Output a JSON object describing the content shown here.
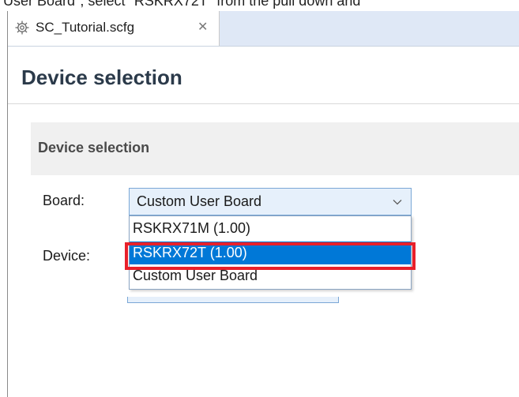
{
  "caption": "User Board\", select \"RSKRX72T\" from the pull down and",
  "tab": {
    "title": "SC_Tutorial.scfg",
    "icon": "gear-icon",
    "close_icon": "close-icon"
  },
  "page": {
    "title": "Device selection"
  },
  "section": {
    "title": "Device selection"
  },
  "board": {
    "label": "Board:",
    "selected_value": "Custom User Board",
    "options": [
      "RSKRX71M (1.00)",
      "RSKRX72T (1.00)",
      "Custom User Board"
    ],
    "highlighted_option": "RSKRX72T (1.00)"
  },
  "device": {
    "label": "Device:"
  },
  "colors": {
    "selection_blue": "#0078d7",
    "highlight_red": "#e8202a",
    "tab_bar": "#dfe8f6"
  }
}
